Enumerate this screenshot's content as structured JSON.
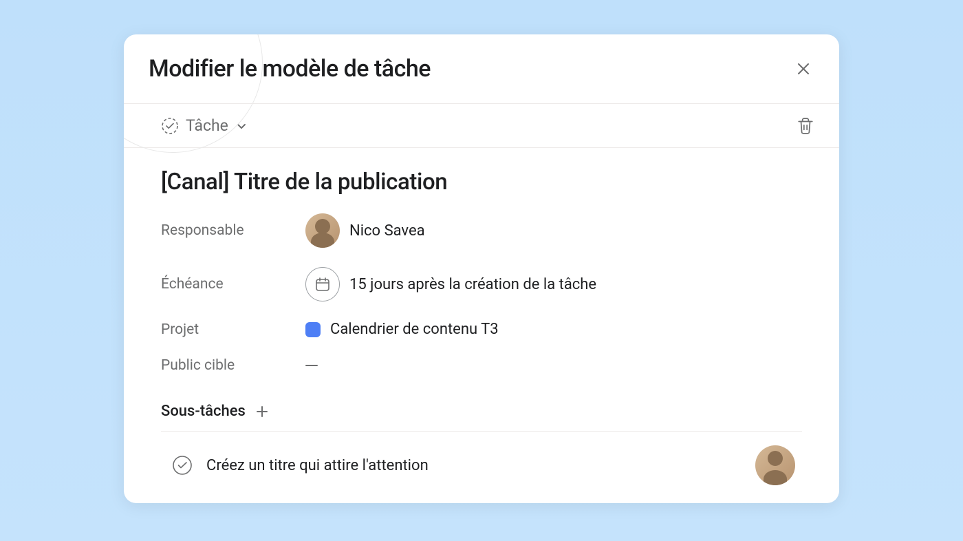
{
  "modal": {
    "title": "Modifier le modèle de tâche"
  },
  "toolbar": {
    "type_label": "Tâche"
  },
  "task": {
    "title": "[Canal] Titre de la publication"
  },
  "fields": {
    "assignee": {
      "label": "Responsable",
      "value": "Nico Savea"
    },
    "due": {
      "label": "Échéance",
      "value": "15 jours après la création de la tâche"
    },
    "project": {
      "label": "Projet",
      "value": "Calendrier de contenu T3",
      "color": "#4e7ff5"
    },
    "audience": {
      "label": "Public cible"
    }
  },
  "subtasks": {
    "header": "Sous-tâches",
    "items": [
      {
        "title": "Créez un titre qui attire l'attention"
      }
    ]
  }
}
